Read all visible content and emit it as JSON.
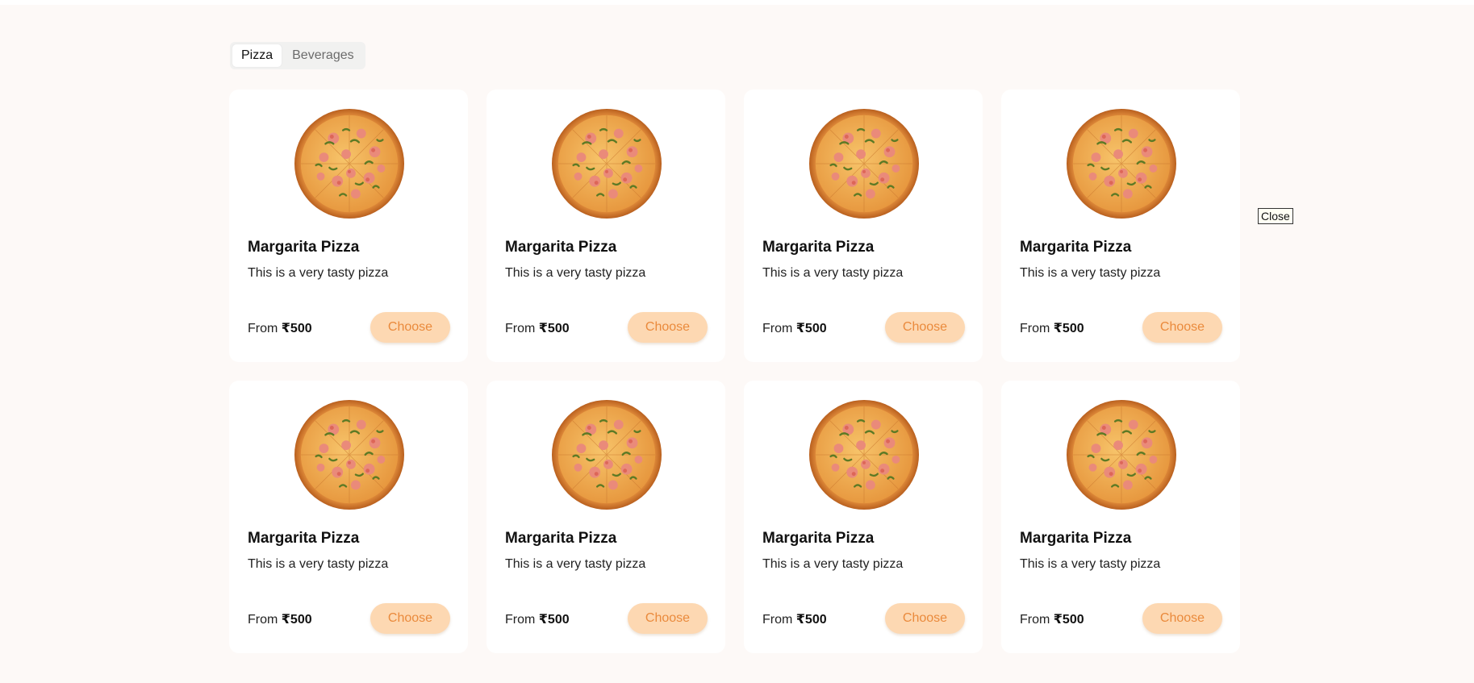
{
  "tabs": [
    {
      "label": "Pizza",
      "active": true
    },
    {
      "label": "Beverages",
      "active": false
    }
  ],
  "products": [
    {
      "name": "Margarita Pizza",
      "description": "This is a very tasty pizza",
      "price_prefix": "From",
      "price": "₹500",
      "button_label": "Choose"
    },
    {
      "name": "Margarita Pizza",
      "description": "This is a very tasty pizza",
      "price_prefix": "From",
      "price": "₹500",
      "button_label": "Choose"
    },
    {
      "name": "Margarita Pizza",
      "description": "This is a very tasty pizza",
      "price_prefix": "From",
      "price": "₹500",
      "button_label": "Choose"
    },
    {
      "name": "Margarita Pizza",
      "description": "This is a very tasty pizza",
      "price_prefix": "From",
      "price": "₹500",
      "button_label": "Choose"
    },
    {
      "name": "Margarita Pizza",
      "description": "This is a very tasty pizza",
      "price_prefix": "From",
      "price": "₹500",
      "button_label": "Choose"
    },
    {
      "name": "Margarita Pizza",
      "description": "This is a very tasty pizza",
      "price_prefix": "From",
      "price": "₹500",
      "button_label": "Choose"
    },
    {
      "name": "Margarita Pizza",
      "description": "This is a very tasty pizza",
      "price_prefix": "From",
      "price": "₹500",
      "button_label": "Choose"
    },
    {
      "name": "Margarita Pizza",
      "description": "This is a very tasty pizza",
      "price_prefix": "From",
      "price": "₹500",
      "button_label": "Choose"
    }
  ],
  "overlay": {
    "close_label": "Close"
  },
  "colors": {
    "page_background": "#fdf9f7",
    "card_background": "#ffffff",
    "button_background": "#fdd8b2",
    "button_text": "#ea8a3c"
  },
  "icons": {
    "product_image": "pizza-image"
  }
}
